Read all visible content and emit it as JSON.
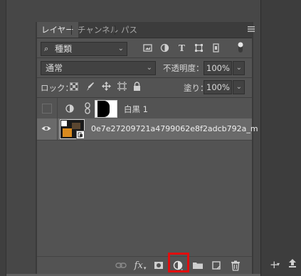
{
  "tabs": [
    {
      "label": "レイヤー",
      "active": true
    },
    {
      "label": "チャンネル",
      "active": false
    },
    {
      "label": "パス",
      "active": false
    }
  ],
  "filter": {
    "kind_label": "種類"
  },
  "blend_mode": {
    "value": "通常"
  },
  "opacity": {
    "label": "不透明度：",
    "value": "100%"
  },
  "lock": {
    "label": "ロック："
  },
  "fill": {
    "label": "塗り：",
    "value": "100%"
  },
  "layers": [
    {
      "name": "白黒 1",
      "type": "adjustment",
      "visible": false
    },
    {
      "name": "0e7e27209721a4799062e8f2adcb792a_m",
      "type": "image",
      "visible": true,
      "selected": true
    }
  ],
  "bottom_bar": {
    "icons": [
      "link-icon",
      "fx-icon",
      "mask-icon",
      "adjustment-layer-icon",
      "folder-icon",
      "new-layer-icon",
      "trash-icon"
    ],
    "fx_label": "fx",
    "highlight": "adjustment-layer-icon",
    "highlight_color": "#e10e0e"
  },
  "colors": {
    "panel": "#535353",
    "selected_row": "#6a6a6a",
    "tab_bar": "#3c3c3c"
  }
}
